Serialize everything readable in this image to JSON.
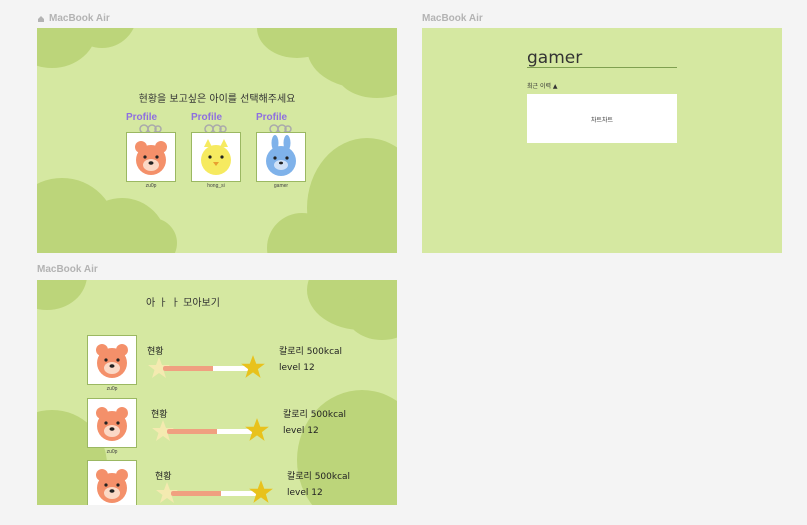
{
  "frames": {
    "one_label": "MacBook Air",
    "two_label": "MacBook Air",
    "three_label": "MacBook Air"
  },
  "select_screen": {
    "prompt": "현황을 보고싶은 아이를 선택해주세요",
    "profiles": [
      {
        "tag": "Profile",
        "name": "zu0p",
        "animal": "bear-icon",
        "color": "#f4906a"
      },
      {
        "tag": "Profile",
        "name": "hong_si",
        "animal": "chick-icon",
        "color": "#f6ea60"
      },
      {
        "tag": "Profile",
        "name": "gamer",
        "animal": "bunny-icon",
        "color": "#7fb2ea"
      }
    ]
  },
  "detail_screen": {
    "username": "gamer",
    "recent_label": "최근 이력 ▲",
    "box_text": "차트차트"
  },
  "overview_screen": {
    "title": "아 ㅏ ㅏ 모아보기",
    "rows": [
      {
        "name": "zu0p",
        "status": "현황",
        "calories": "칼로리 500kcal",
        "level": "level 12",
        "progress": 0.55
      },
      {
        "name": "zu0p",
        "status": "현황",
        "calories": "칼로리 500kcal",
        "level": "level 12",
        "progress": 0.55
      },
      {
        "name": "",
        "status": "현황",
        "calories": "칼로리 500kcal",
        "level": "level 12",
        "progress": 0.55
      }
    ]
  },
  "colors": {
    "frame_bg": "#d5e8a1",
    "cloud": "#bcd57a",
    "profile_tag": "#8e6fe0",
    "bar_fill": "#f0a080",
    "star_light": "#f4eab0",
    "star_dark": "#e8c21c"
  }
}
